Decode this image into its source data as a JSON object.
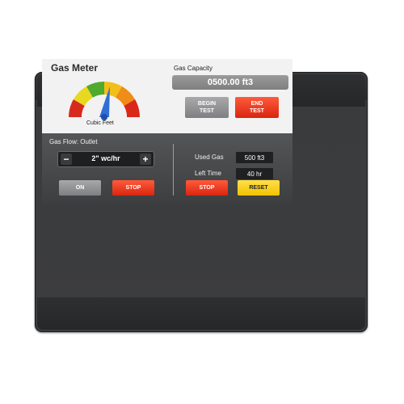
{
  "meter": {
    "title": "Gas Meter",
    "gauge_caption": "Cubic Feet",
    "gauge_zones": [
      "#d62a1c",
      "#e8d81f",
      "#4faa2e",
      "#f2bf1a",
      "#f08c17",
      "#d9281a"
    ]
  },
  "capacity": {
    "label": "Gas Capacity",
    "value": "0500.00 ft3"
  },
  "test": {
    "begin_line1": "BEGIN",
    "begin_line2": "TEST",
    "end_line1": "END",
    "end_line2": "TEST"
  },
  "flow": {
    "label": "Gas Flow: Outlet",
    "minus": "−",
    "value": "2\" wc/hr",
    "plus": "+",
    "on_label": "ON",
    "stop_label": "STOP"
  },
  "usage": {
    "used_label": "Used Gas",
    "used_value": "500 ft3",
    "time_label": "Left Time",
    "time_value": "40 hr",
    "stop_label": "STOP",
    "reset_label": "RESET"
  }
}
